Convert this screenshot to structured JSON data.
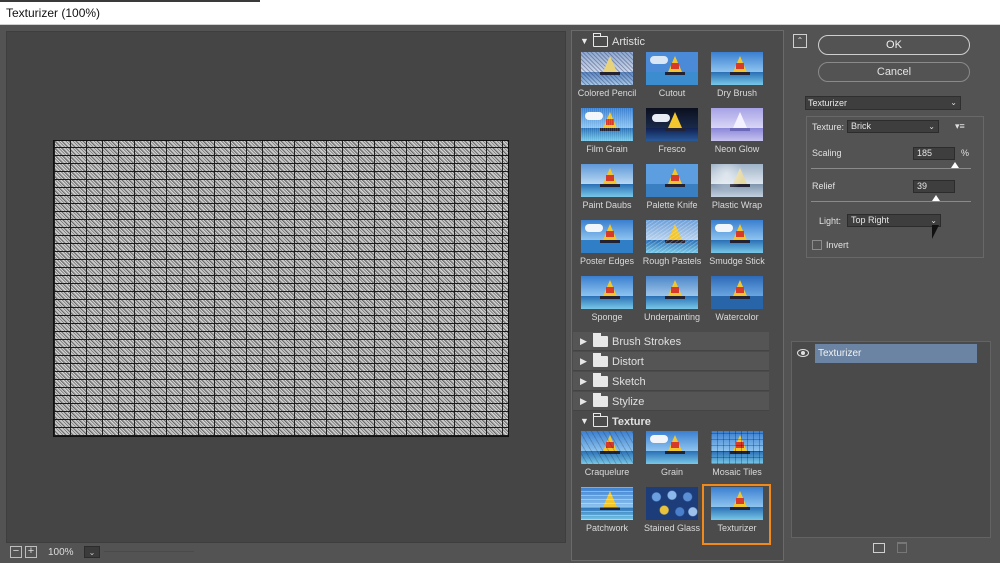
{
  "window": {
    "title": "Texturizer (100%)"
  },
  "preview": {
    "zoom_out": "−",
    "zoom_in": "+",
    "zoom_value": "100%",
    "zoom_dropdown": "⌄"
  },
  "gallery": {
    "folders": {
      "artistic": "Artistic",
      "brush_strokes": "Brush Strokes",
      "distort": "Distort",
      "sketch": "Sketch",
      "stylize": "Stylize",
      "texture": "Texture"
    },
    "artistic_items": [
      "Colored Pencil",
      "Cutout",
      "Dry Brush",
      "Film Grain",
      "Fresco",
      "Neon Glow",
      "Paint Daubs",
      "Palette Knife",
      "Plastic Wrap",
      "Poster Edges",
      "Rough Pastels",
      "Smudge Stick",
      "Sponge",
      "Underpainting",
      "Watercolor"
    ],
    "texture_items": [
      "Craquelure",
      "Grain",
      "Mosaic Tiles",
      "Patchwork",
      "Stained Glass",
      "Texturizer"
    ],
    "selected": "Texturizer"
  },
  "controls": {
    "ok": "OK",
    "cancel": "Cancel",
    "filter_select": "Texturizer",
    "texture_label": "Texture:",
    "texture_value": "Brick",
    "texture_menu_icon": "▾≡",
    "scaling_label": "Scaling",
    "scaling_value": "185",
    "scaling_unit": "%",
    "scaling_level": 185,
    "relief_label": "Relief",
    "relief_value": "39",
    "relief_level": 39,
    "light_label": "Light:",
    "light_value": "Top Right",
    "invert_label": "Invert",
    "invert_checked": false
  },
  "layers": {
    "items": [
      "Texturizer"
    ]
  },
  "icons": {
    "collapse": "chevrons-up-icon",
    "eye": "eye-icon",
    "new_layer": "new-effect-layer-icon",
    "delete_layer": "trash-icon"
  }
}
